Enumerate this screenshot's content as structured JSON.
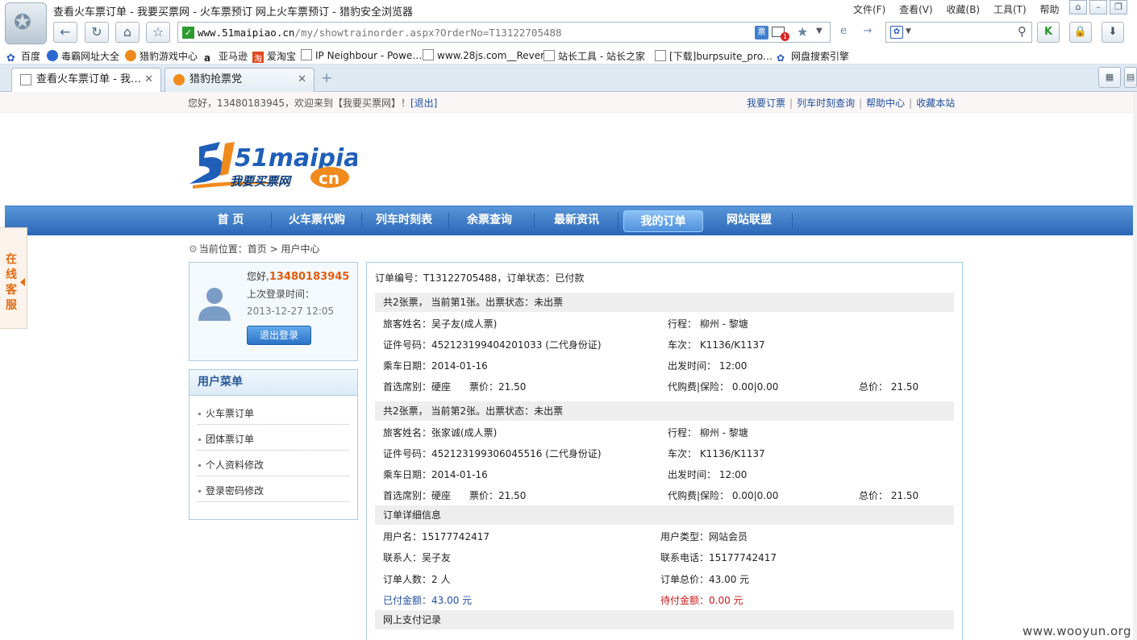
{
  "browser": {
    "window_title": "查看火车票订单 - 我要买票网 - 火车票预订 网上火车票预订 - 猎豹安全浏览器",
    "menus": [
      "文件(F)",
      "查看(V)",
      "收藏(B)",
      "工具(T)",
      "帮助"
    ],
    "url_host": "www.51maipiao.cn",
    "url_path": "/my/showtrainorder.aspx?OrderNo=T13122705488",
    "ticket_icon_label": "票",
    "notification_count": "1",
    "favorites": [
      {
        "label": "百度",
        "icon": "baidu-icon"
      },
      {
        "label": "毒霸网址大全",
        "icon": "duba-icon"
      },
      {
        "label": "猎豹游戏中心",
        "icon": "cheetah-icon"
      },
      {
        "label": "亚马逊",
        "icon": "amazon-icon"
      },
      {
        "label": "爱淘宝",
        "icon": "taobao-icon"
      },
      {
        "label": "IP Neighbour - Powe…",
        "icon": "page-icon"
      },
      {
        "label": "www.28js.com__Rever…",
        "icon": "page-icon"
      },
      {
        "label": "站长工具 - 站长之家",
        "icon": "page-icon"
      },
      {
        "label": "[下载]burpsuite_pro…",
        "icon": "page-icon"
      },
      {
        "label": "网盘搜索引擎",
        "icon": "paw-icon"
      }
    ],
    "tabs": [
      {
        "label": "查看火车票订单 - 我…",
        "active": true
      },
      {
        "label": "猎豹抢票党",
        "active": false
      }
    ],
    "new_tab": "+"
  },
  "site": {
    "welcome_prefix": "您好，13480183945，欢迎来到【我要买票网】！",
    "logout_link": "[退出]",
    "top_links": [
      "我要订票",
      "列车时刻查询",
      "帮助中心",
      "收藏本站"
    ],
    "logo_text": "51maipiao",
    "logo_sub": "我要买票网",
    "logo_cn": "cn",
    "nav": [
      "首 页",
      "火车票代购",
      "列车时刻表",
      "余票查询",
      "最新资讯",
      "我的订单",
      "网站联盟"
    ],
    "nav_active": "我的订单",
    "online_service": "在线客服",
    "breadcrumb": {
      "prefix": "当前位置：首页",
      "sep": ">",
      "current": "用户中心"
    }
  },
  "user": {
    "hello": "您好,",
    "username": "13480183945",
    "last_login_label": "上次登录时间：",
    "last_login_time": "2013-12-27 12:05",
    "logout_button": "退出登录"
  },
  "user_menu": {
    "title": "用户菜单",
    "items": [
      "火车票订单",
      "团体票订单",
      "个人资料修改",
      "登录密码修改"
    ]
  },
  "order": {
    "header": "订单编号：T13122705488，订单状态：已付款",
    "tickets": [
      {
        "section": "共2张票， 当前第1张。出票状态：未出票",
        "passenger": "旅客姓名：吴子友(成人票)",
        "route": "行程： 柳州 - 黎塘",
        "id_no": "证件号码：452123199404201033 (二代身份证)",
        "train": "车次： K1136/K1137",
        "date": "乘车日期：2014-01-16",
        "depart": "出发时间： 12:00",
        "seat": "首选席别：硬座",
        "price": "票价：21.50",
        "fee": "代购费|保险： 0.00|0.00",
        "total": "总价： 21.50"
      },
      {
        "section": "共2张票， 当前第2张。出票状态：未出票",
        "passenger": "旅客姓名：张家诚(成人票)",
        "route": "行程： 柳州 - 黎塘",
        "id_no": "证件号码：452123199306045516 (二代身份证)",
        "train": "车次： K1136/K1137",
        "date": "乘车日期：2014-01-16",
        "depart": "出发时间： 12:00",
        "seat": "首选席别：硬座",
        "price": "票价：21.50",
        "fee": "代购费|保险： 0.00|0.00",
        "total": "总价： 21.50"
      }
    ],
    "detail_title": "订单详细信息",
    "username": "用户名：15177742417",
    "user_type": "用户类型：网站会员",
    "contact": "联系人：吴子友",
    "phone": "联系电话：15177742417",
    "count": "订单人数：2 人",
    "order_total": "订单总价：43.00 元",
    "paid": "已付金额：43.00 元",
    "unpaid": "待付金额：0.00 元",
    "pay_record_title": "网上支付记录"
  },
  "watermark": "www.wooyun.org",
  "colors": {
    "nav_blue": "#2a66b6",
    "accent_orange": "#e25d0e",
    "link_blue": "#1f4fa0",
    "unpaid_red": "#c81818"
  }
}
